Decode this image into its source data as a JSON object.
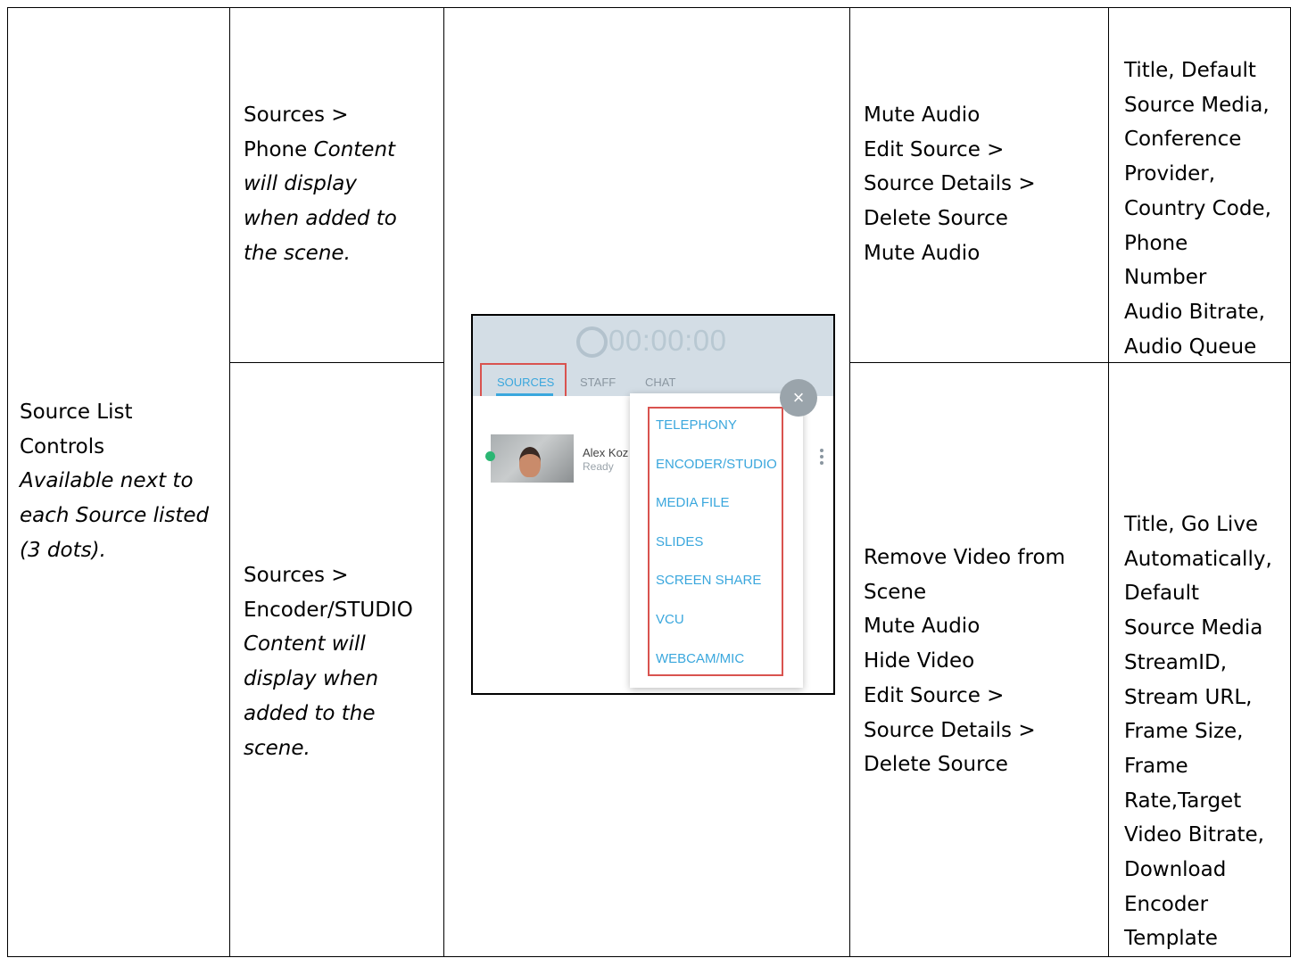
{
  "row_label": {
    "line1": "Source List",
    "line2": "Controls",
    "line3": "Available next to",
    "line4": "each Source listed",
    "line5": "(3 dots)."
  },
  "rows": [
    {
      "source_lines": [
        "Sources >",
        "Phone ",
        "will display",
        "when added to",
        "the scene."
      ],
      "source_italic_inline": "Content",
      "actions": [
        "Mute Audio",
        "Edit Source >",
        "Source Details >",
        "Delete Source",
        "Mute Audio"
      ],
      "fields": [
        "Title, Default",
        "Source Media,",
        "Conference",
        "Provider,",
        "Country Code,",
        "Phone",
        "Number",
        "Audio Bitrate,",
        "Audio Queue"
      ]
    },
    {
      "source_lines": [
        "Sources >",
        "Encoder/STUDIO",
        "Content will",
        "display when",
        "added to the",
        "scene."
      ],
      "actions": [
        "Remove Video from",
        "Scene",
        "Mute Audio",
        "Hide Video",
        "Edit Source >",
        "Source Details >",
        "Delete Source"
      ],
      "fields": [
        "Title, Go Live",
        "Automatically,",
        "Default",
        "Source Media",
        "StreamID,",
        "Stream URL,",
        "Frame Size,",
        "Frame",
        "Rate,Target",
        "Video Bitrate,",
        "Download",
        "Encoder",
        "Template"
      ]
    }
  ],
  "screenshot": {
    "timer": "00:00:00",
    "tabs": [
      "SOURCES",
      "STAFF",
      "CHAT"
    ],
    "source_name": "Alex Koz",
    "source_status": "Ready",
    "close_symbol": "×",
    "menu_items": [
      "TELEPHONY",
      "ENCODER/STUDIO",
      "MEDIA FILE",
      "SLIDES",
      "SCREEN SHARE",
      "VCU",
      "WEBCAM/MIC"
    ],
    "colors": {
      "accent": "#3aa7dd",
      "highlight_box": "#d9534f",
      "live_dot": "#2bb673",
      "header_bg": "#d3dde5"
    }
  }
}
